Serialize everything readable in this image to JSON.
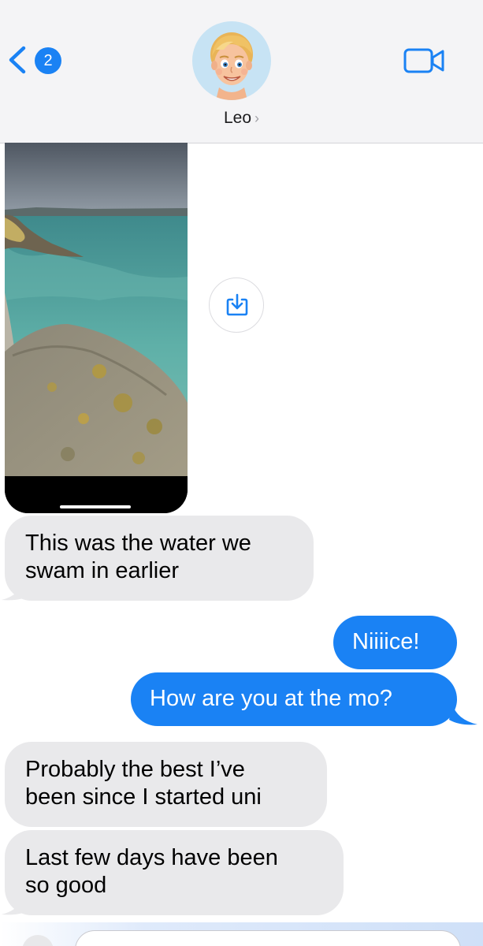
{
  "header": {
    "back_badge_count": "2",
    "contact_name": "Leo",
    "name_chevron": "›",
    "icons": {
      "back": "chevron-left-icon",
      "video": "video-camera-icon",
      "avatar": "memoji-avatar"
    }
  },
  "colors": {
    "accent_blue": "#1a82f4",
    "incoming_bubble": "#e9e9eb",
    "header_bg": "#f4f4f6"
  },
  "messages": [
    {
      "direction": "incoming",
      "type": "photo",
      "description_icon": "save-to-photos-icon"
    },
    {
      "direction": "incoming",
      "lines": [
        "This was the water we",
        "swam in earlier"
      ]
    },
    {
      "direction": "outgoing",
      "lines": [
        "Niiiice!"
      ]
    },
    {
      "direction": "outgoing",
      "lines": [
        "How are you at the mo?"
      ]
    },
    {
      "direction": "incoming",
      "lines": [
        "Probably the best I’ve",
        "been since I started uni"
      ]
    },
    {
      "direction": "incoming",
      "lines": [
        "Last few days have been",
        "so good"
      ]
    }
  ]
}
